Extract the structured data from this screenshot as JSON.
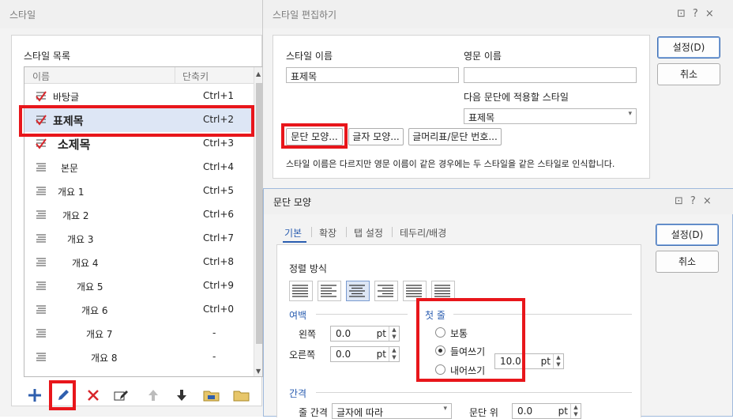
{
  "style_dialog": {
    "title": "스타일",
    "list_title": "스타일 목록",
    "columns": {
      "name": "이름",
      "shortcut": "단축키"
    },
    "items": [
      {
        "name": "바탕글",
        "shortcut": "Ctrl+1"
      },
      {
        "name": "표제목",
        "shortcut": "Ctrl+2"
      },
      {
        "name": "소제목",
        "shortcut": "Ctrl+3"
      },
      {
        "name": "본문",
        "shortcut": "Ctrl+4"
      },
      {
        "name": "개요 1",
        "shortcut": "Ctrl+5"
      },
      {
        "name": "개요 2",
        "shortcut": "Ctrl+6"
      },
      {
        "name": "개요 3",
        "shortcut": "Ctrl+7"
      },
      {
        "name": "개요 4",
        "shortcut": "Ctrl+8"
      },
      {
        "name": "개요 5",
        "shortcut": "Ctrl+9"
      },
      {
        "name": "개요 6",
        "shortcut": "Ctrl+0"
      },
      {
        "name": "개요 7",
        "shortcut": "-"
      },
      {
        "name": "개요 8",
        "shortcut": "-"
      }
    ],
    "toolbar_icons": [
      "add-icon",
      "edit-pencil-icon",
      "delete-icon",
      "edit-shortcut-icon",
      "move-up-icon",
      "move-down-icon",
      "import-icon",
      "open-folder-icon"
    ]
  },
  "edit_dialog": {
    "title": "스타일 편집하기",
    "style_name_label": "스타일 이름",
    "style_name_value": "표제목",
    "english_name_label": "영문 이름",
    "english_name_value": "",
    "next_style_label": "다음 문단에 적용할 스타일",
    "next_style_value": "표제목",
    "paragraph_button": "문단 모양...",
    "char_button": "글자 모양...",
    "bullet_button": "글머리표/문단 번호...",
    "note": "스타일 이름은 다르지만 영문 이름이 같은 경우에는 두 스타일을 같은 스타일로 인식합니다.",
    "ok": "설정(D)",
    "cancel": "취소"
  },
  "para_dialog": {
    "title": "문단 모양",
    "tabs": [
      "기본",
      "확장",
      "탭 설정",
      "테두리/배경"
    ],
    "align_label": "정렬 방식",
    "margin_label": "여백",
    "left_label": "왼쪽",
    "left_value": "0.0",
    "right_label": "오른쪽",
    "right_value": "0.0",
    "unit": "pt",
    "first_line_label": "첫 줄",
    "radio_normal": "보통",
    "radio_indent": "들여쓰기",
    "radio_outdent": "내어쓰기",
    "indent_value": "10.0",
    "spacing_label": "간격",
    "line_spacing_label": "줄 간격",
    "line_spacing_value": "글자에 따라",
    "para_above_label": "문단 위",
    "para_above_value": "0.0",
    "ok": "설정(D)",
    "cancel": "취소"
  },
  "window_icons": {
    "help": "?",
    "close": "×",
    "extra": "⊡"
  }
}
